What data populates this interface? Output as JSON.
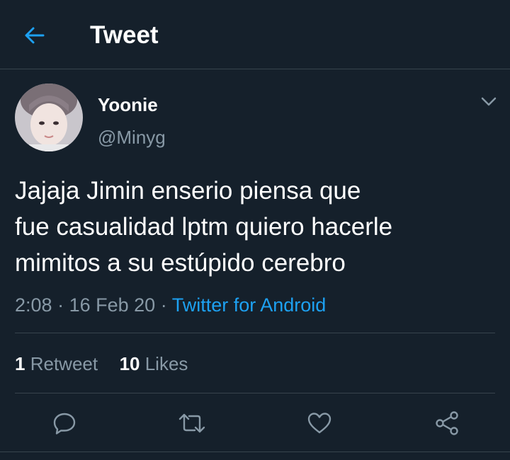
{
  "header": {
    "title": "Tweet",
    "back_icon": "arrow-left-icon"
  },
  "tweet": {
    "user": {
      "name": "Yoonie",
      "handle": "@Minyg"
    },
    "text_lines": [
      "Jajaja Jimin enserio piensa que",
      "fue casualidad lptm quiero hacerle",
      "mimitos a su estúpido cerebro"
    ],
    "time": "2:08",
    "date": "16 Feb 20",
    "separator": "·",
    "source": "Twitter for Android",
    "stats": {
      "retweets_count": "1",
      "retweets_label": "Retweet",
      "likes_count": "10",
      "likes_label": "Likes"
    }
  },
  "colors": {
    "background": "#15202b",
    "accent": "#1da1f2",
    "secondary_text": "#8899a6",
    "divider": "#38444d"
  },
  "icons": [
    "arrow-left-icon",
    "chevron-down-icon",
    "reply-icon",
    "retweet-icon",
    "like-icon",
    "share-icon"
  ]
}
